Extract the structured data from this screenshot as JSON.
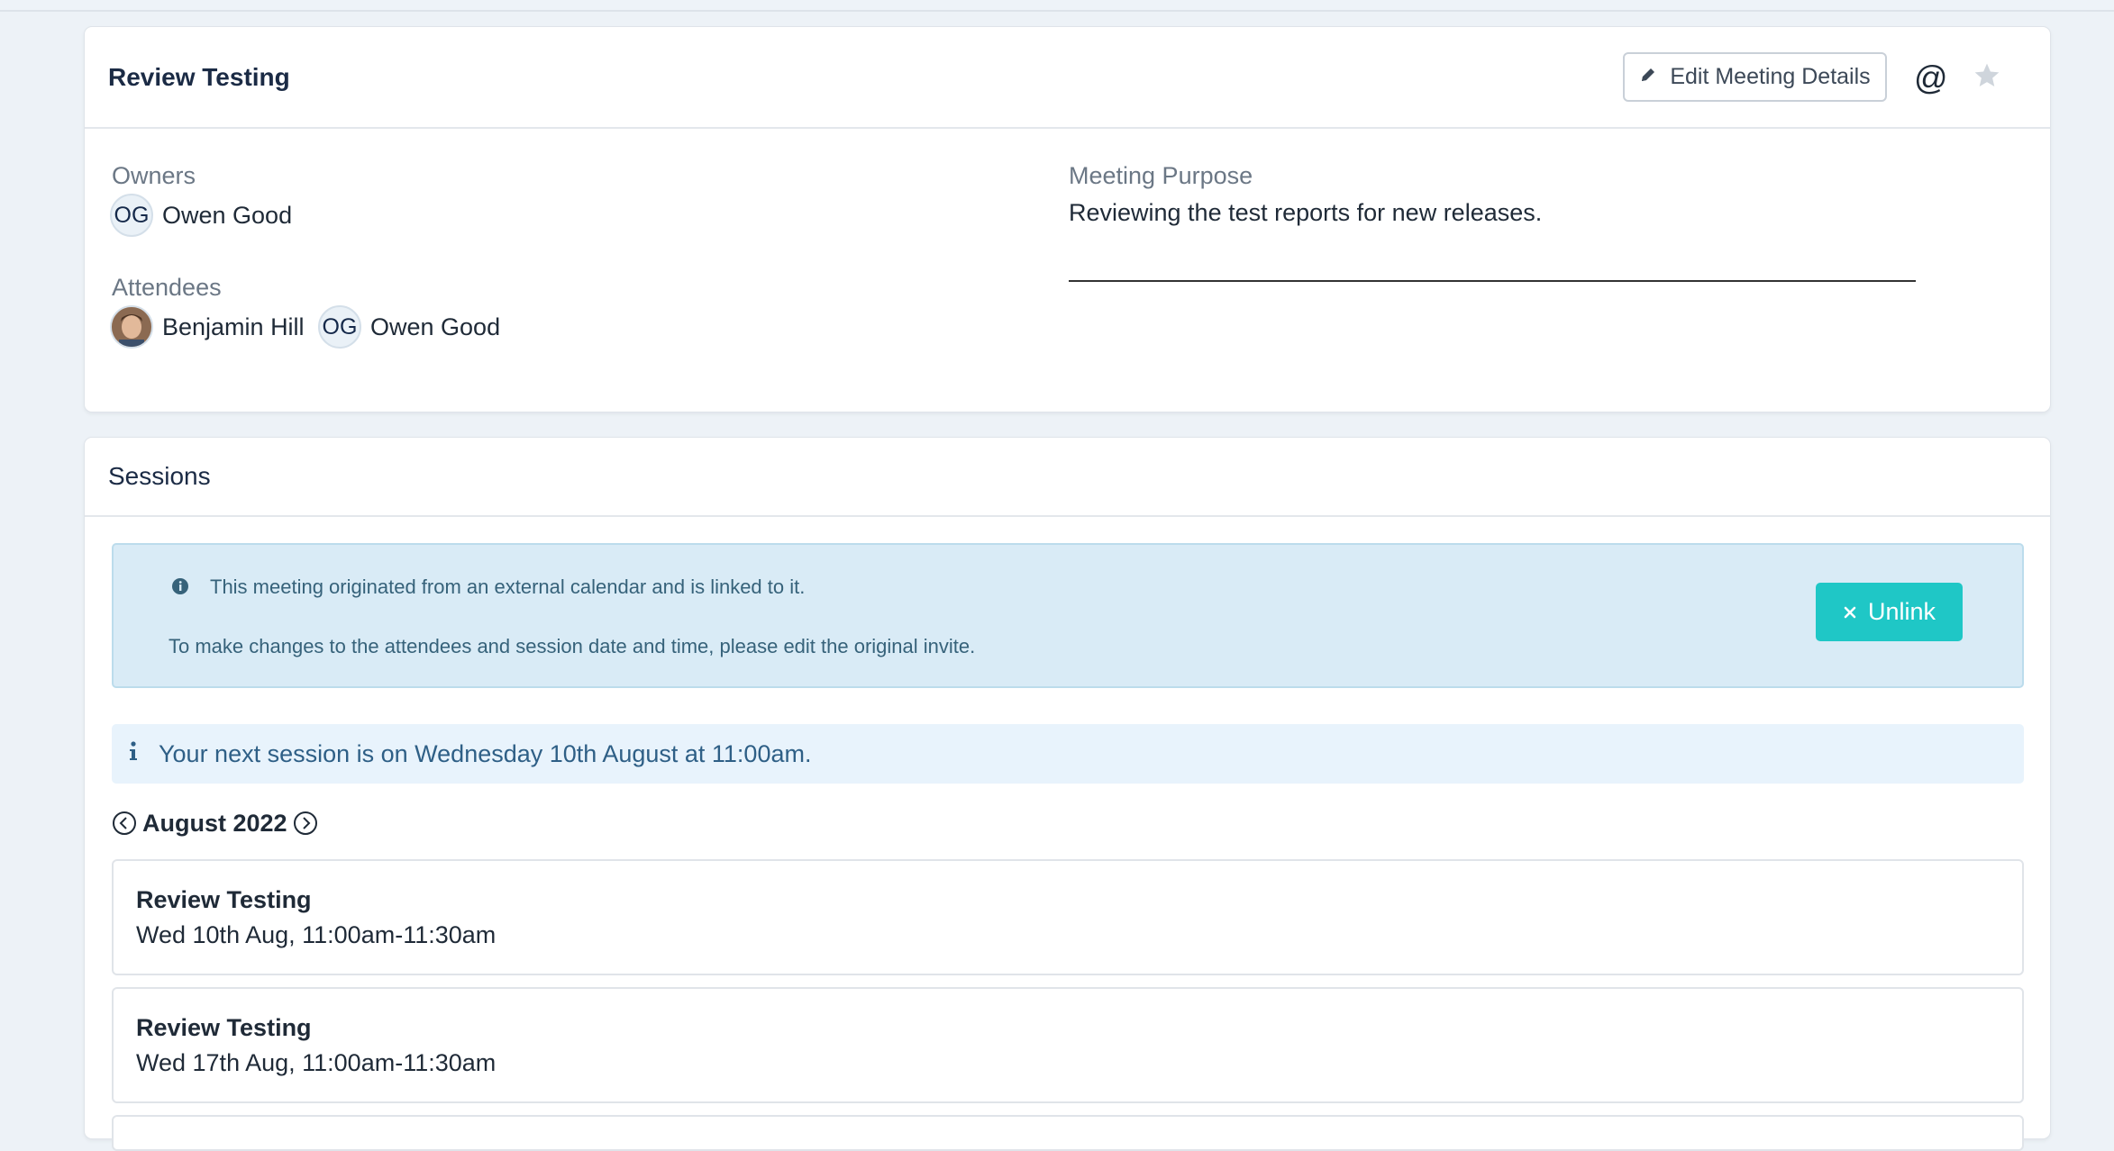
{
  "meeting": {
    "title": "Review Testing",
    "edit_label": "Edit Meeting Details",
    "owners_label": "Owners",
    "owners": [
      {
        "initials": "OG",
        "name": "Owen Good"
      }
    ],
    "attendees_label": "Attendees",
    "attendees": [
      {
        "initials": "",
        "name": "Benjamin Hill",
        "avatar": "photo"
      },
      {
        "initials": "OG",
        "name": "Owen Good"
      }
    ],
    "purpose_label": "Meeting Purpose",
    "purpose_text": "Reviewing the test reports for new releases."
  },
  "sessions": {
    "title": "Sessions",
    "alert_line1": "This meeting originated from an external calendar and is linked to it.",
    "alert_line2": "To make changes to the attendees and session date and time, please edit the original invite.",
    "unlink_label": "Unlink",
    "next_session": "Your next session is on Wednesday 10th August at 11:00am.",
    "month": "August 2022",
    "items": [
      {
        "name": "Review Testing",
        "time": "Wed 10th Aug, 11:00am-11:30am"
      },
      {
        "name": "Review Testing",
        "time": "Wed 17th Aug, 11:00am-11:30am"
      }
    ]
  },
  "colors": {
    "accent": "#1fc7c6",
    "alert_bg": "#d9ebf6",
    "info_bg": "#e8f3fc",
    "title": "#1b2b45"
  },
  "icons": [
    "pencil-icon",
    "at-icon",
    "star-icon",
    "info-circle-icon",
    "info-icon",
    "close-icon",
    "chevron-left-icon",
    "chevron-right-icon"
  ]
}
